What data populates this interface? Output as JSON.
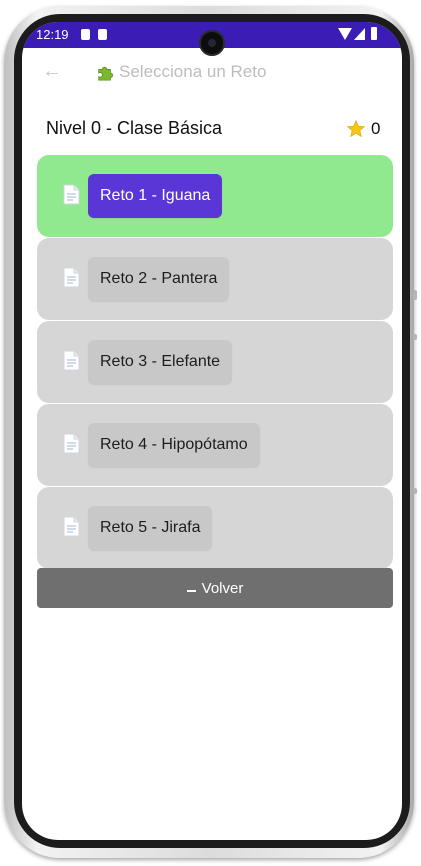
{
  "status_bar": {
    "time": "12:19"
  },
  "app_bar": {
    "back_glyph": "←",
    "title": "Selecciona un Reto",
    "icon": "puzzle-icon"
  },
  "level": {
    "title": "Nivel 0 - Clase Básica",
    "stars": "0",
    "star_icon": "star-icon"
  },
  "challenges": [
    {
      "label": "Reto 1 - Iguana",
      "active": true,
      "icon": "document-icon"
    },
    {
      "label": "Reto 2 - Pantera",
      "active": false,
      "icon": "document-icon"
    },
    {
      "label": "Reto 3 - Elefante",
      "active": false,
      "icon": "document-icon"
    },
    {
      "label": "Reto 4 - Hipopótamo",
      "active": false,
      "icon": "document-icon"
    },
    {
      "label": "Reto 5 - Jirafa",
      "active": false,
      "icon": "document-icon"
    }
  ],
  "back_button": {
    "label": "Volver"
  },
  "colors": {
    "status_bar": "#3b1cb5",
    "active_card": "#90e88f",
    "active_button": "#5b36d6",
    "inactive_card": "#d6d6d6",
    "back_button": "#6f6f6f"
  }
}
